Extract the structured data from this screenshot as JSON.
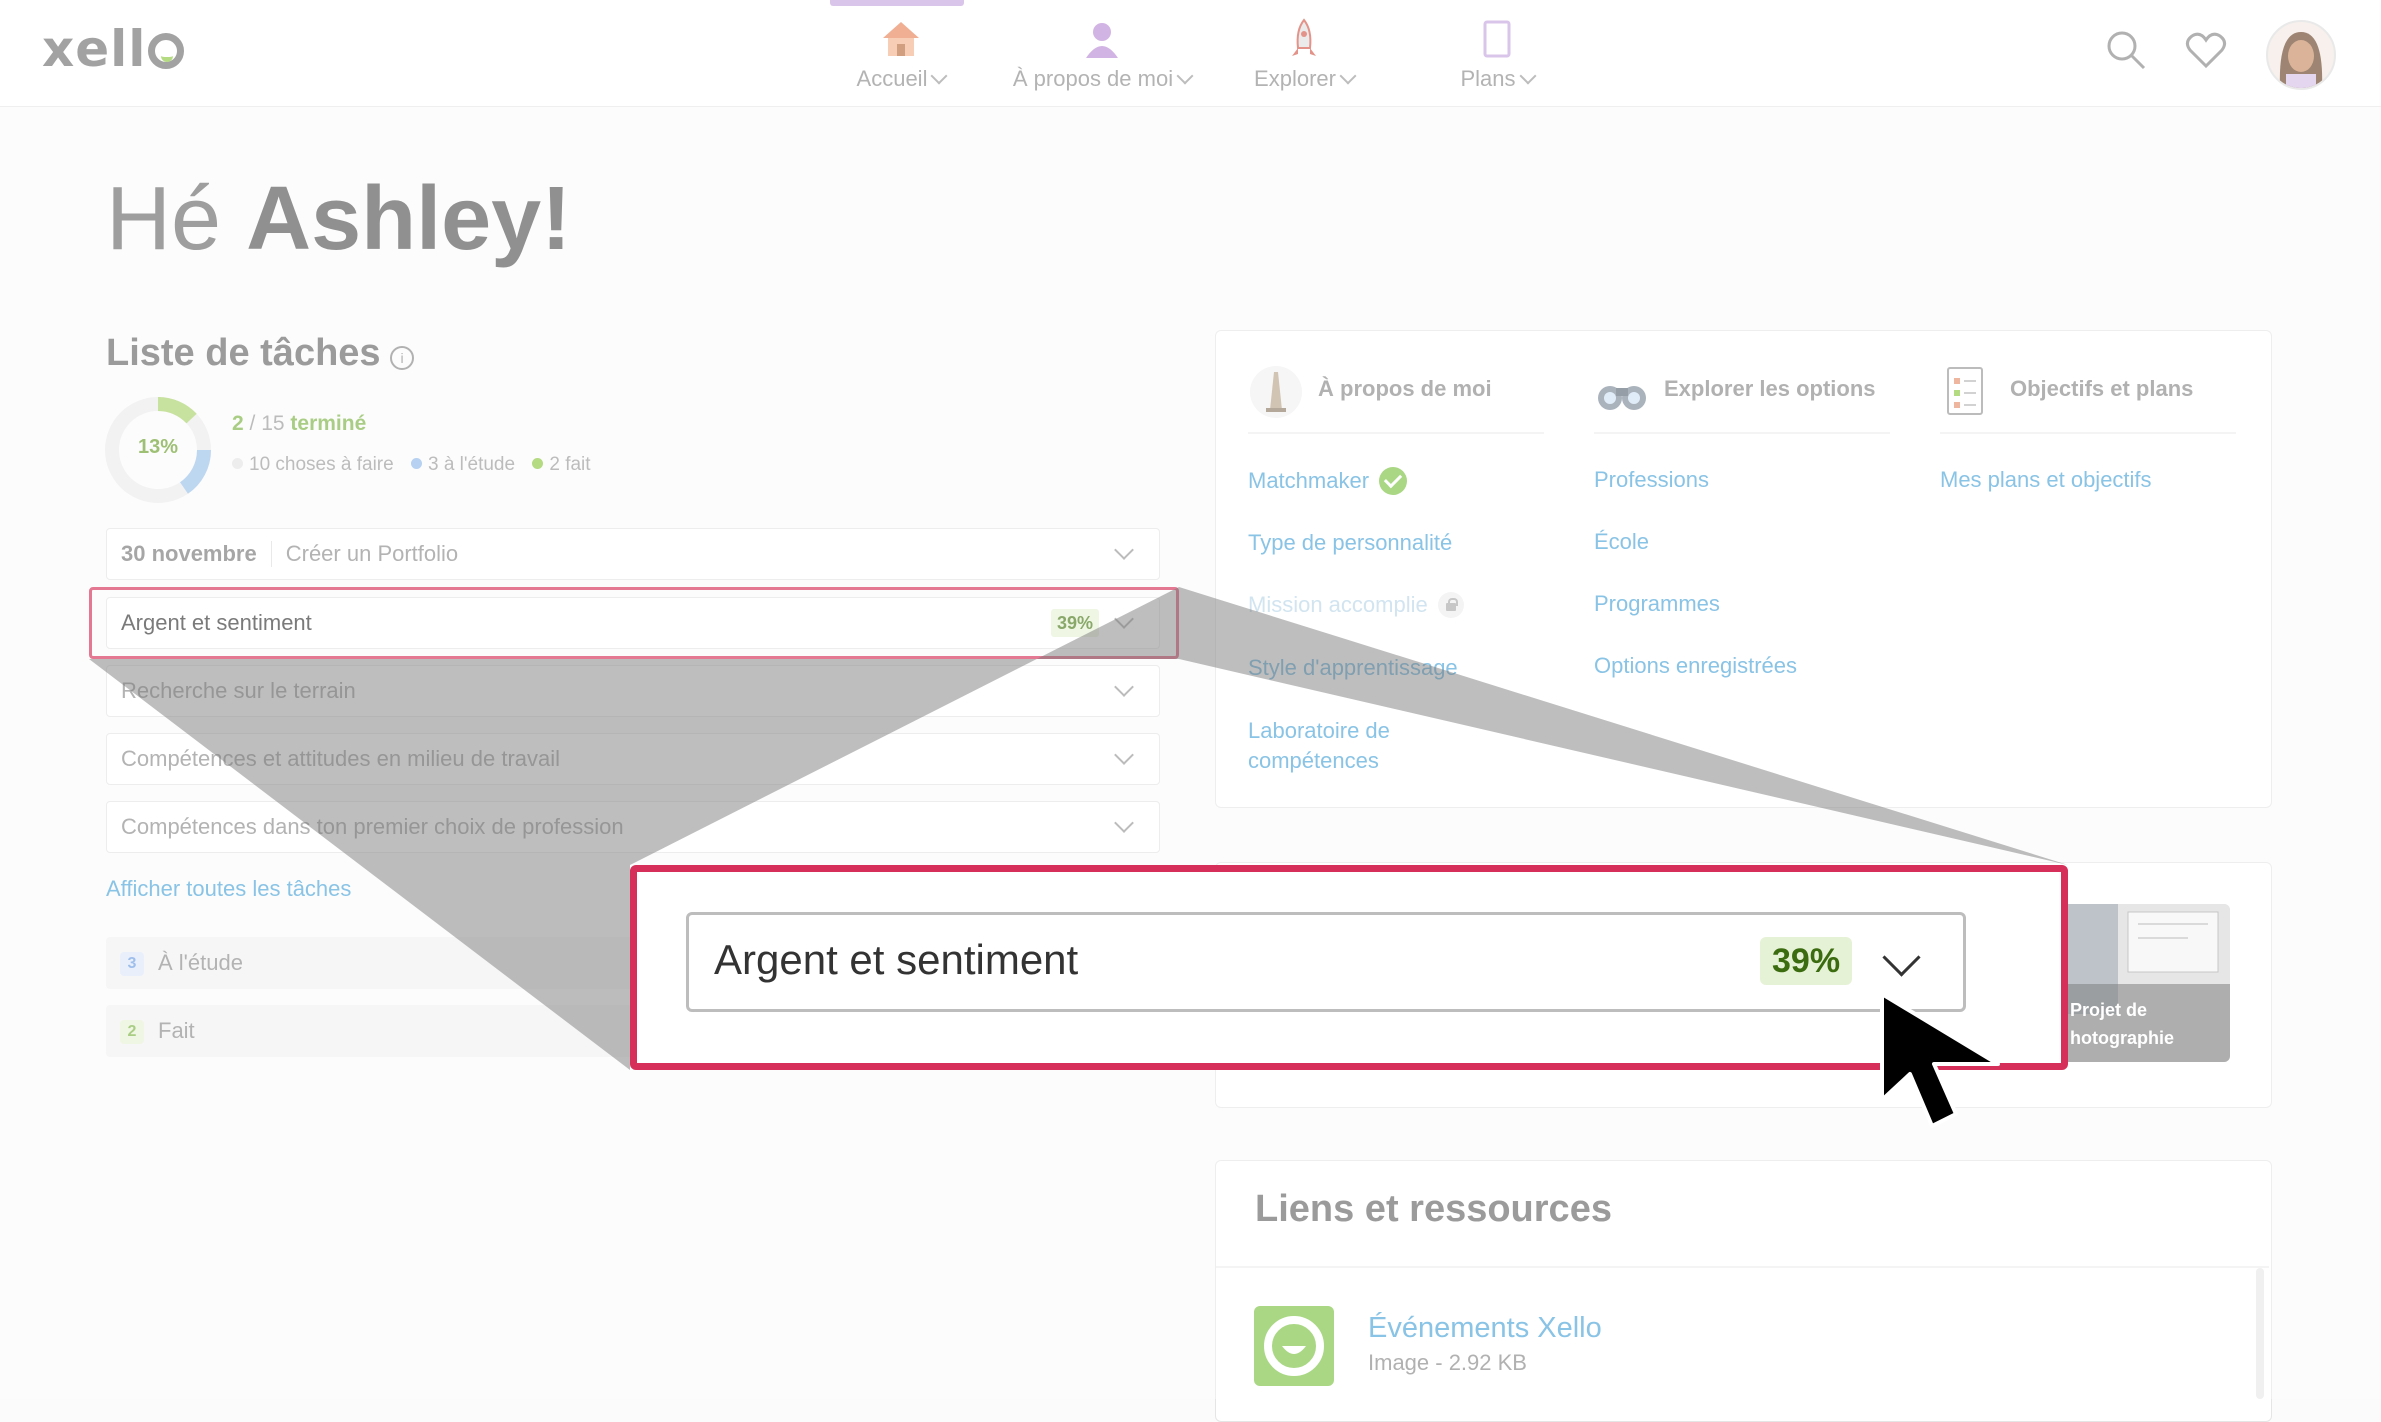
{
  "header": {
    "logo": "xello",
    "nav": [
      {
        "label": "Accueil"
      },
      {
        "label": "À propos de moi"
      },
      {
        "label": "Explorer"
      },
      {
        "label": "Plans"
      }
    ]
  },
  "greeting": {
    "prefix": "Hé",
    "name": "Ashley!"
  },
  "tasks": {
    "title": "Liste de tâches",
    "donut_pct": "13%",
    "donut_fraction": 0.13,
    "progress_done": "2",
    "progress_total": " / 15 ",
    "progress_word": "terminé",
    "legend": [
      "10 choses à faire",
      "3 à l'étude",
      "2 fait"
    ],
    "rows": [
      {
        "date": "30 novembre",
        "label": "Créer un Portfolio"
      },
      {
        "label": "Argent et sentiment",
        "pct": "39%"
      },
      {
        "label": "Recherche sur le terrain"
      },
      {
        "label": "Compétences et attitudes en milieu de travail"
      },
      {
        "label": "Compétences dans ton premier choix de profession"
      }
    ],
    "show_all": "Afficher toutes les tâches",
    "groups": [
      {
        "count": "3",
        "label": "À l'étude"
      },
      {
        "count": "2",
        "label": "Fait"
      }
    ]
  },
  "panel": {
    "columns": [
      {
        "title": "À propos de moi",
        "links": [
          "Matchmaker",
          "Type de personnalité",
          "Mission accomplie",
          "Style d'apprentissage",
          "Laboratoire de",
          "compétences"
        ]
      },
      {
        "title": "Explorer les options",
        "links": [
          "Professions",
          "École",
          "Programmes",
          "Options enregistrées"
        ]
      },
      {
        "title": "Objectifs et plans",
        "links": [
          "Mes plans et objectifs"
        ]
      }
    ]
  },
  "card": {
    "caption_line1": "Projet de",
    "caption_line2": "hotographie"
  },
  "resources": {
    "title": "Liens et ressources",
    "item_title": "Événements Xello",
    "item_meta": "Image - 2.92 KB"
  },
  "zoom": {
    "label": "Argent et sentiment",
    "pct": "39%"
  },
  "colors": {
    "accent": "#d6305a",
    "link": "#4aa3d8",
    "green": "#7cc242",
    "purple": "#c6a7df"
  }
}
